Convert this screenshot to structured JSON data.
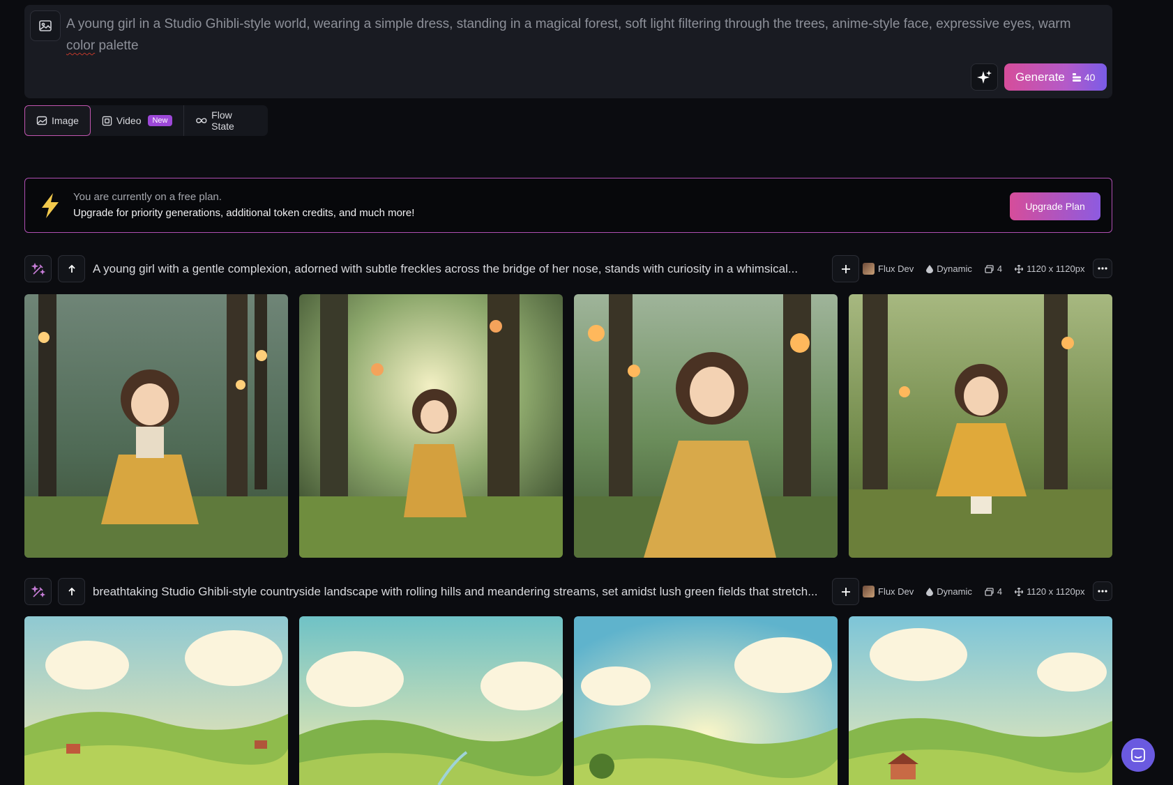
{
  "prompt": {
    "text_part1": "A young girl in a Studio Ghibli-style world, wearing a simple dress, standing in a magical forest, soft light filtering through the trees, anime-style face, expressive eyes, warm ",
    "text_misspelled": "color",
    "text_part2": " palette",
    "generate_label": "Generate",
    "token_cost": "40"
  },
  "tabs": [
    {
      "label": "Image",
      "icon": "image-icon",
      "active": true
    },
    {
      "label": "Video",
      "icon": "video-icon",
      "badge": "New"
    },
    {
      "label": "Flow State",
      "icon": "infinity-icon"
    }
  ],
  "banner": {
    "line1": "You are currently on a free plan.",
    "line2": "Upgrade for priority generations, additional token credits, and much more!",
    "button": "Upgrade Plan"
  },
  "generations": [
    {
      "prompt": "A young girl with a gentle complexion, adorned with subtle freckles across the bridge of her nose, stands with curiosity in a whimsical...",
      "model": "Flux Dev",
      "style": "Dynamic",
      "count": "4",
      "size": "1120 x 1120px",
      "images": [
        "forest-girl-1",
        "forest-girl-2",
        "forest-girl-3",
        "forest-girl-4"
      ]
    },
    {
      "prompt": "breathtaking Studio Ghibli-style countryside landscape with rolling hills and meandering streams, set amidst lush green fields that stretch...",
      "model": "Flux Dev",
      "style": "Dynamic",
      "count": "4",
      "size": "1120 x 1120px",
      "images": [
        "countryside-1",
        "countryside-2",
        "countryside-3",
        "countryside-4"
      ]
    }
  ],
  "colors": {
    "accent_pink": "#d64d9a",
    "accent_purple": "#7a5ce8",
    "background": "#0b0c10"
  }
}
